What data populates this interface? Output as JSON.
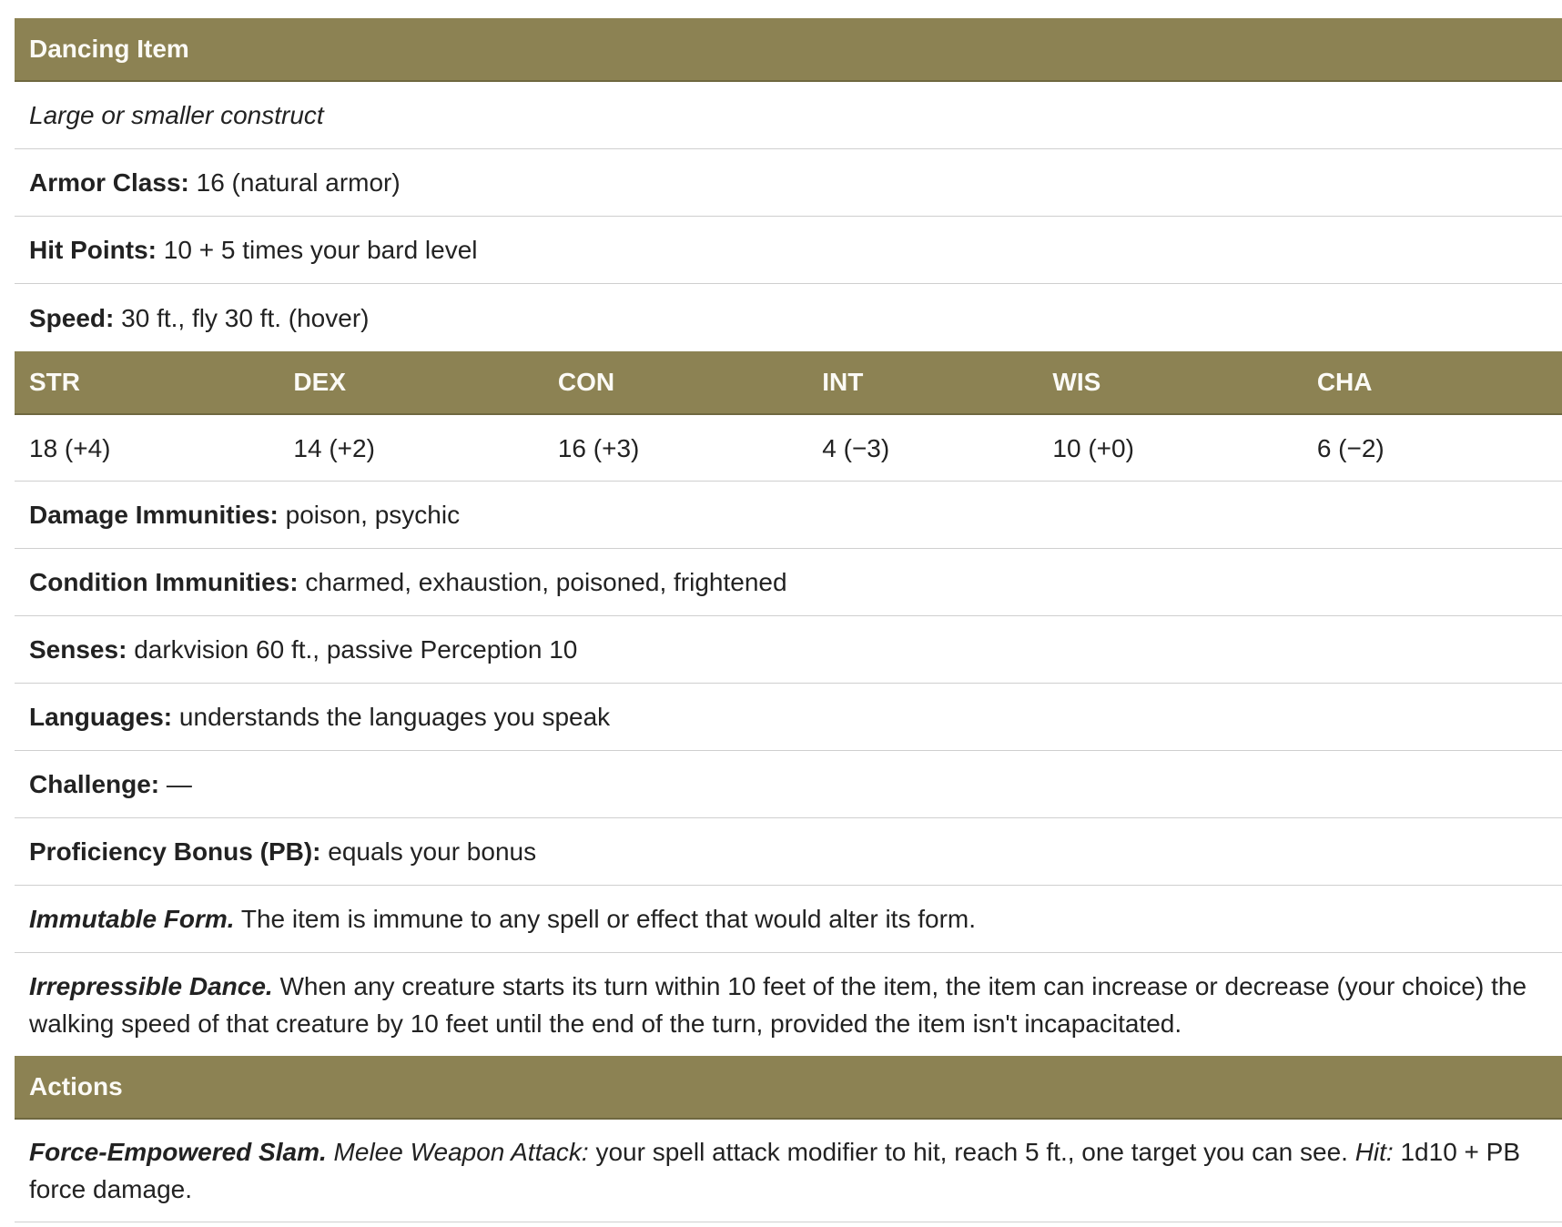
{
  "statblock": {
    "name": "Dancing Item",
    "type": "Large or smaller construct",
    "armor_class": {
      "label": "Armor Class:",
      "value": "16 (natural armor)"
    },
    "hit_points": {
      "label": "Hit Points:",
      "value": "10 + 5 times your bard level"
    },
    "speed": {
      "label": "Speed:",
      "value": "30 ft., fly 30 ft. (hover)"
    },
    "abilities": {
      "headers": [
        "STR",
        "DEX",
        "CON",
        "INT",
        "WIS",
        "CHA"
      ],
      "values": [
        "18 (+4)",
        "14 (+2)",
        "16 (+3)",
        "4 (−3)",
        "10 (+0)",
        "6 (−2)"
      ]
    },
    "damage_immunities": {
      "label": "Damage Immunities:",
      "value": "poison, psychic"
    },
    "condition_immunities": {
      "label": "Condition Immunities:",
      "value": "charmed, exhaustion, poisoned, frightened"
    },
    "senses": {
      "label": "Senses:",
      "value": "darkvision 60 ft., passive Perception 10"
    },
    "languages": {
      "label": "Languages:",
      "value": "understands the languages you speak"
    },
    "challenge": {
      "label": "Challenge:",
      "value": "—"
    },
    "proficiency": {
      "label": "Proficiency Bonus (PB):",
      "value": "equals your bonus"
    },
    "traits": [
      {
        "name": "Immutable Form.",
        "text": "The item is immune to any spell or effect that would alter its form."
      },
      {
        "name": "Irrepressible Dance.",
        "text": "When any creature starts its turn within 10 feet of the item, the item can increase or decrease (your choice) the walking speed of that creature by 10 feet until the end of the turn, provided the item isn't incapacitated."
      }
    ],
    "actions_header": "Actions",
    "actions": [
      {
        "name": "Force-Empowered Slam.",
        "attack_type": "Melee Weapon Attack:",
        "attack_text": "your spell attack modifier to hit, reach 5 ft., one target you can see.",
        "hit_label": "Hit:",
        "hit_text": "1d10 + PB force damage."
      }
    ]
  }
}
